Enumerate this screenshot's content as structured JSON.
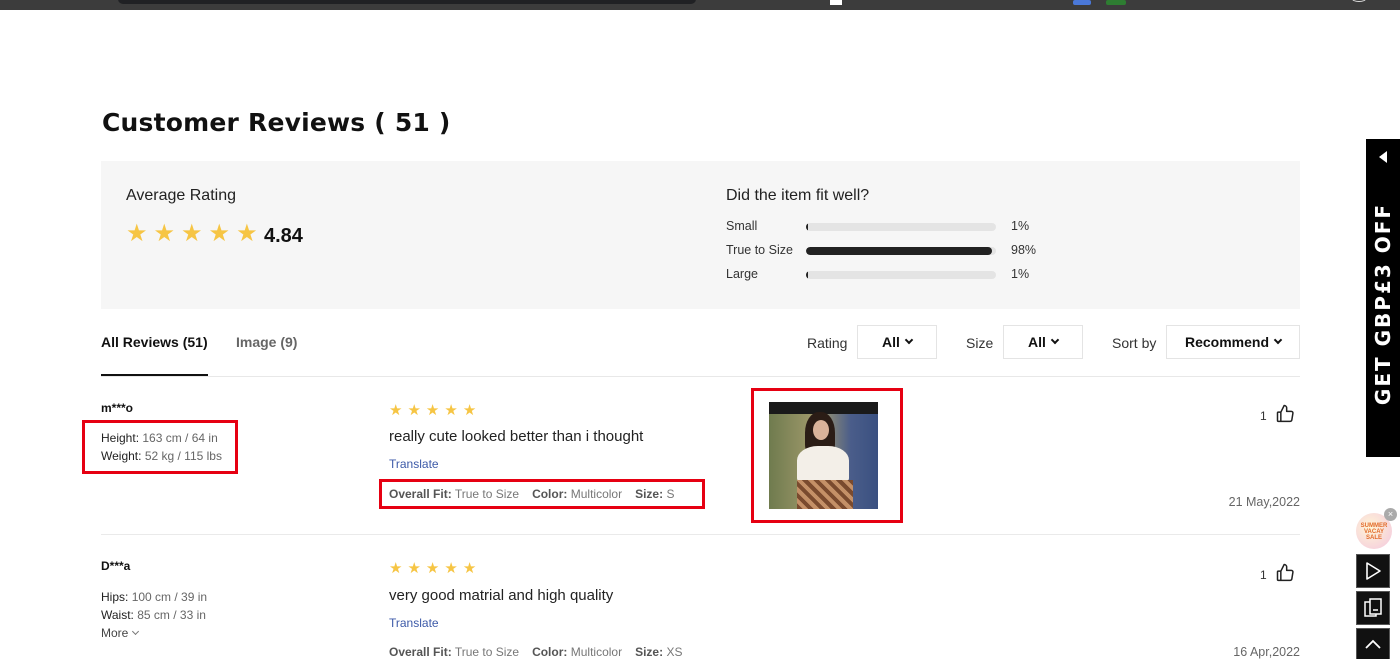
{
  "page": {
    "title": "Customer Reviews ( 51 )"
  },
  "summary": {
    "avg_label": "Average Rating",
    "avg_value": "4.84",
    "avg_stars": 5,
    "fit_title": "Did the item fit well?",
    "fit_rows": [
      {
        "label": "Small",
        "percent": 1,
        "percent_label": "1%"
      },
      {
        "label": "True to Size",
        "percent": 98,
        "percent_label": "98%"
      },
      {
        "label": "Large",
        "percent": 1,
        "percent_label": "1%"
      }
    ]
  },
  "tabs": {
    "all_reviews": "All Reviews (51)",
    "image": "Image (9)"
  },
  "filters": {
    "rating_label": "Rating",
    "rating_value": "All",
    "size_label": "Size",
    "size_value": "All",
    "sort_label": "Sort by",
    "sort_value": "Recommend"
  },
  "reviews": [
    {
      "user": "m***o",
      "measurements": [
        {
          "label": "Height:",
          "value": "163 cm / 64 in"
        },
        {
          "label": "Weight:",
          "value": "52 kg / 115 lbs"
        }
      ],
      "stars": 5,
      "text": "really cute looked better than i thought",
      "translate": "Translate",
      "fit_label": "Overall Fit:",
      "fit_value": "True to Size",
      "color_label": "Color:",
      "color_value": "Multicolor",
      "size_label": "Size:",
      "size_value": "S",
      "likes": "1",
      "date": "21 May,2022"
    },
    {
      "user": "D***a",
      "measurements": [
        {
          "label": "Hips:",
          "value": "100 cm / 39 in"
        },
        {
          "label": "Waist:",
          "value": "85 cm / 33 in"
        }
      ],
      "more": "More",
      "stars": 5,
      "text": "very good matrial and high quality",
      "translate": "Translate",
      "fit_label": "Overall Fit:",
      "fit_value": "True to Size",
      "color_label": "Color:",
      "color_value": "Multicolor",
      "size_label": "Size:",
      "size_value": "XS",
      "likes": "1",
      "date": "16 Apr,2022"
    }
  ],
  "side": {
    "banner_text": "GET GBP£3 OFF",
    "promo_text": "SUMMER VACAY SALE",
    "close_symbol": "×"
  },
  "colors": {
    "star": "#f6c544",
    "highlight": "#e60012",
    "link": "#3d5aa8",
    "summary_bg": "#f6f6f6"
  },
  "icons": [
    "star-icon",
    "chevron-down-icon",
    "thumbs-up-icon",
    "play-icon",
    "copy-icon",
    "chevron-up-icon",
    "close-icon"
  ]
}
